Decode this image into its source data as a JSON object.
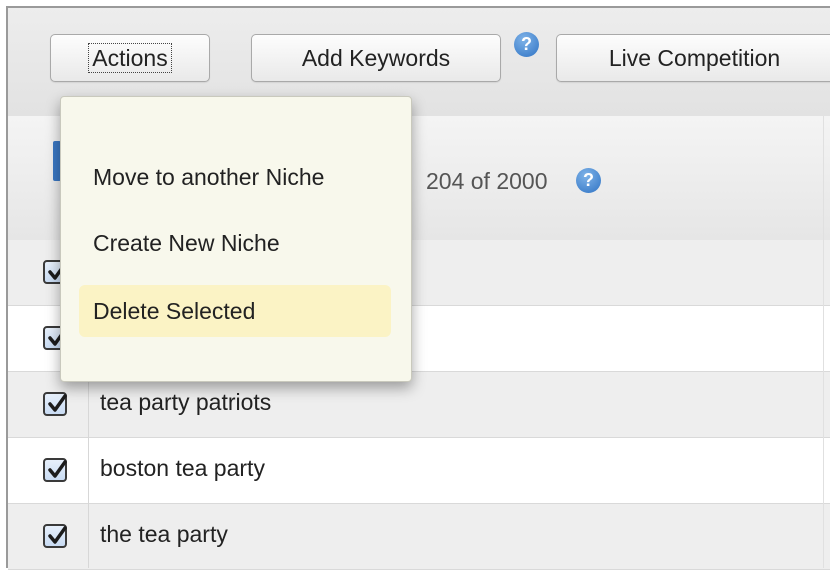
{
  "toolbar": {
    "actions_label": "Actions",
    "add_keywords_label": "Add Keywords",
    "help_glyph": "?",
    "live_competition_label": "Live Competition"
  },
  "header": {
    "count_text": "204 of 2000",
    "help_glyph": "?"
  },
  "actions_menu": {
    "items": [
      {
        "label": "Move to another Niche",
        "highlighted": false
      },
      {
        "label": "Create New Niche",
        "highlighted": false
      },
      {
        "label": "Delete Selected",
        "highlighted": true
      }
    ]
  },
  "rows": [
    {
      "text": "",
      "checked": true
    },
    {
      "text": "",
      "checked": true
    },
    {
      "text": "tea party patriots",
      "checked": true
    },
    {
      "text": "boston tea party",
      "checked": true
    },
    {
      "text": "the tea party",
      "checked": true
    }
  ],
  "colors": {
    "checkbox_border": "#3a3a3a",
    "help_icon": "#2f73c4",
    "menu_background": "#f8f8ec",
    "menu_highlight": "#fbf3c5"
  }
}
